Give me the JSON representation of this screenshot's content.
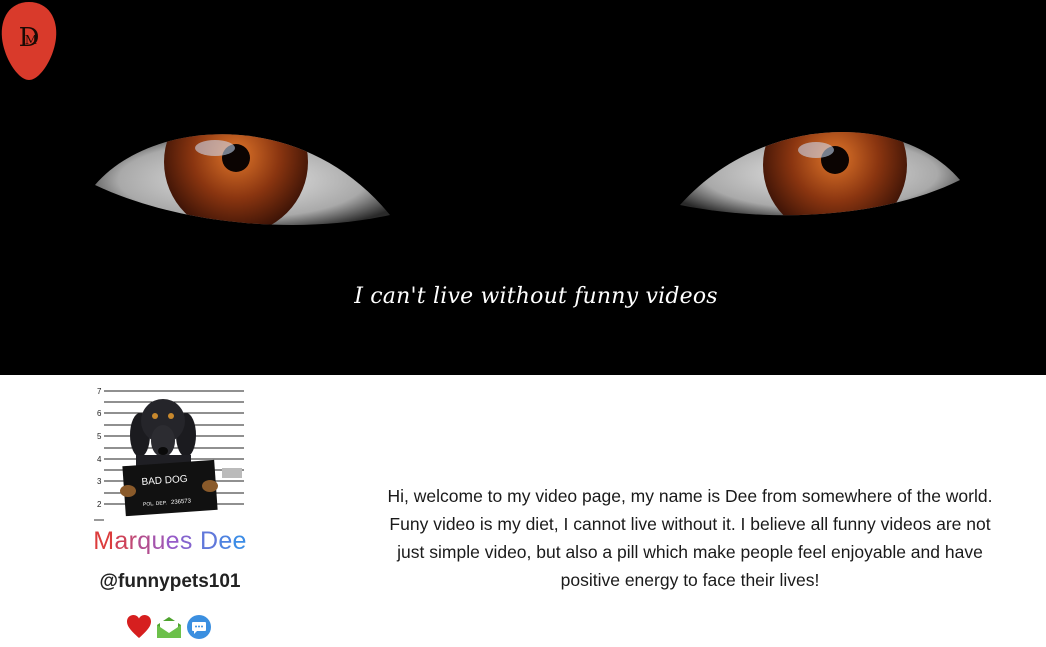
{
  "hero": {
    "tagline": "I can't live without funny videos",
    "logo_icon": "dm-monogram-logo",
    "logo_color": "#d93a2b"
  },
  "profile": {
    "photo": "bad-dog-mugshot-image",
    "photo_text": {
      "sign_main": "BAD DOG",
      "sign_sub": "POL. DEP.",
      "sign_number": "236573",
      "height_marks": [
        "7",
        "6",
        "5",
        "4",
        "3",
        "2"
      ]
    },
    "name": "Marques Dee",
    "handle": "@funnypets101",
    "actions": [
      {
        "icon": "heart-icon",
        "color": "#d61f1f"
      },
      {
        "icon": "mail-icon",
        "color": "#6cc04a"
      },
      {
        "icon": "chat-icon",
        "color": "#3b8fe0"
      }
    ]
  },
  "bio": {
    "text": "Hi, welcome to my video page, my name is Dee from somewhere of the world. Funy video is my diet, I cannot live without it. I believe all funny videos are not just simple video, but also a pill which make people feel enjoyable and have positive energy to face their lives!"
  }
}
